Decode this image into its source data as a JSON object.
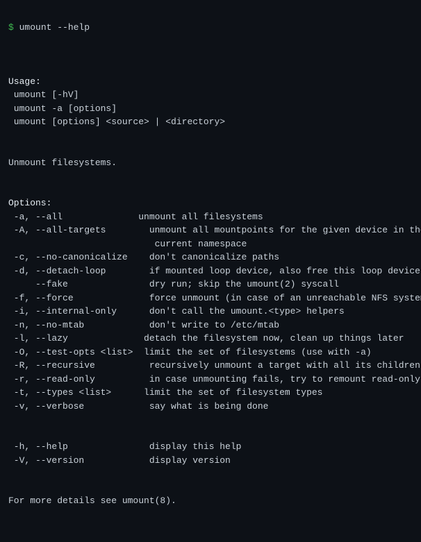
{
  "terminal": {
    "prompt": "$ umount --help",
    "blank1": "",
    "usage_label": "Usage:",
    "usage_lines": [
      " umount [-hV]",
      " umount -a [options]",
      " umount [options] <source> | <directory>"
    ],
    "blank2": "",
    "description": "Unmount filesystems.",
    "blank3": "",
    "options_label": "Options:",
    "options": [
      {
        "flag": " -a, --all",
        "pad": "              ",
        "desc": "unmount all filesystems"
      },
      {
        "flag": " -A, --all-targets",
        "pad": "        ",
        "desc": "unmount all mountpoints for the given device in the"
      },
      {
        "flag": "                  ",
        "pad": "        ",
        "desc": "current namespace"
      },
      {
        "flag": " -c, --no-canonicalize",
        "pad": "    ",
        "desc": "don't canonicalize paths"
      },
      {
        "flag": " -d, --detach-loop",
        "pad": "        ",
        "desc": "if mounted loop device, also free this loop device"
      },
      {
        "flag": "     --fake",
        "pad": "               ",
        "desc": "dry run; skip the umount(2) syscall"
      },
      {
        "flag": " -f, --force",
        "pad": "              ",
        "desc": "force unmount (in case of an unreachable NFS system"
      },
      {
        "flag": " -i, --internal-only",
        "pad": "      ",
        "desc": "don't call the umount.<type> helpers"
      },
      {
        "flag": " -n, --no-mtab",
        "pad": "            ",
        "desc": "don't write to /etc/mtab"
      },
      {
        "flag": " -l, --lazy",
        "pad": "               ",
        "desc": "detach the filesystem now, clean up things later"
      },
      {
        "flag": " -O, --test-opts <list>",
        "pad": "   ",
        "desc": "limit the set of filesystems (use with -a)"
      },
      {
        "flag": " -R, --recursive",
        "pad": "          ",
        "desc": "recursively unmount a target with all its children"
      },
      {
        "flag": " -r, --read-only",
        "pad": "          ",
        "desc": "in case unmounting fails, try to remount read-only"
      },
      {
        "flag": " -t, --types <list>",
        "pad": "       ",
        "desc": "limit the set of filesystem types"
      },
      {
        "flag": " -v, --verbose",
        "pad": "            ",
        "desc": "say what is being done"
      },
      {
        "flag": "",
        "pad": "",
        "desc": ""
      },
      {
        "flag": " -h, --help",
        "pad": "               ",
        "desc": "display this help"
      },
      {
        "flag": " -V, --version",
        "pad": "            ",
        "desc": "display version"
      }
    ],
    "blank4": "",
    "footer": "For more details see umount(8).",
    "blank5": ""
  }
}
